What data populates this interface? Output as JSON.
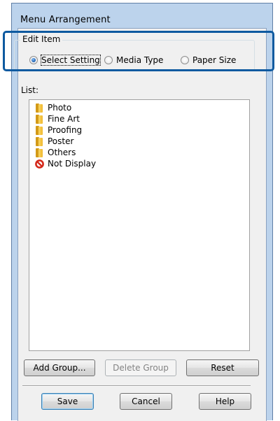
{
  "window": {
    "title": "Menu Arrangement"
  },
  "edit_item": {
    "legend": "Edit Item",
    "options": [
      {
        "label": "Select Setting",
        "selected": true
      },
      {
        "label": "Media Type",
        "selected": false
      },
      {
        "label": "Paper Size",
        "selected": false
      }
    ]
  },
  "list": {
    "label": "List:",
    "items": [
      {
        "label": "Photo",
        "icon": "folder-icon"
      },
      {
        "label": "Fine Art",
        "icon": "folder-icon"
      },
      {
        "label": "Proofing",
        "icon": "folder-icon"
      },
      {
        "label": "Poster",
        "icon": "folder-icon"
      },
      {
        "label": "Others",
        "icon": "folder-icon"
      },
      {
        "label": "Not Display",
        "icon": "not-display-icon"
      }
    ]
  },
  "buttons": {
    "add_group": "Add Group...",
    "delete_group": "Delete Group",
    "reset": "Reset",
    "save": "Save",
    "cancel": "Cancel",
    "help": "Help"
  },
  "colors": {
    "highlight_frame": "#0e5aa0",
    "window_frame": "#bcd3ec",
    "dialog_background": "#f0f0f0"
  }
}
